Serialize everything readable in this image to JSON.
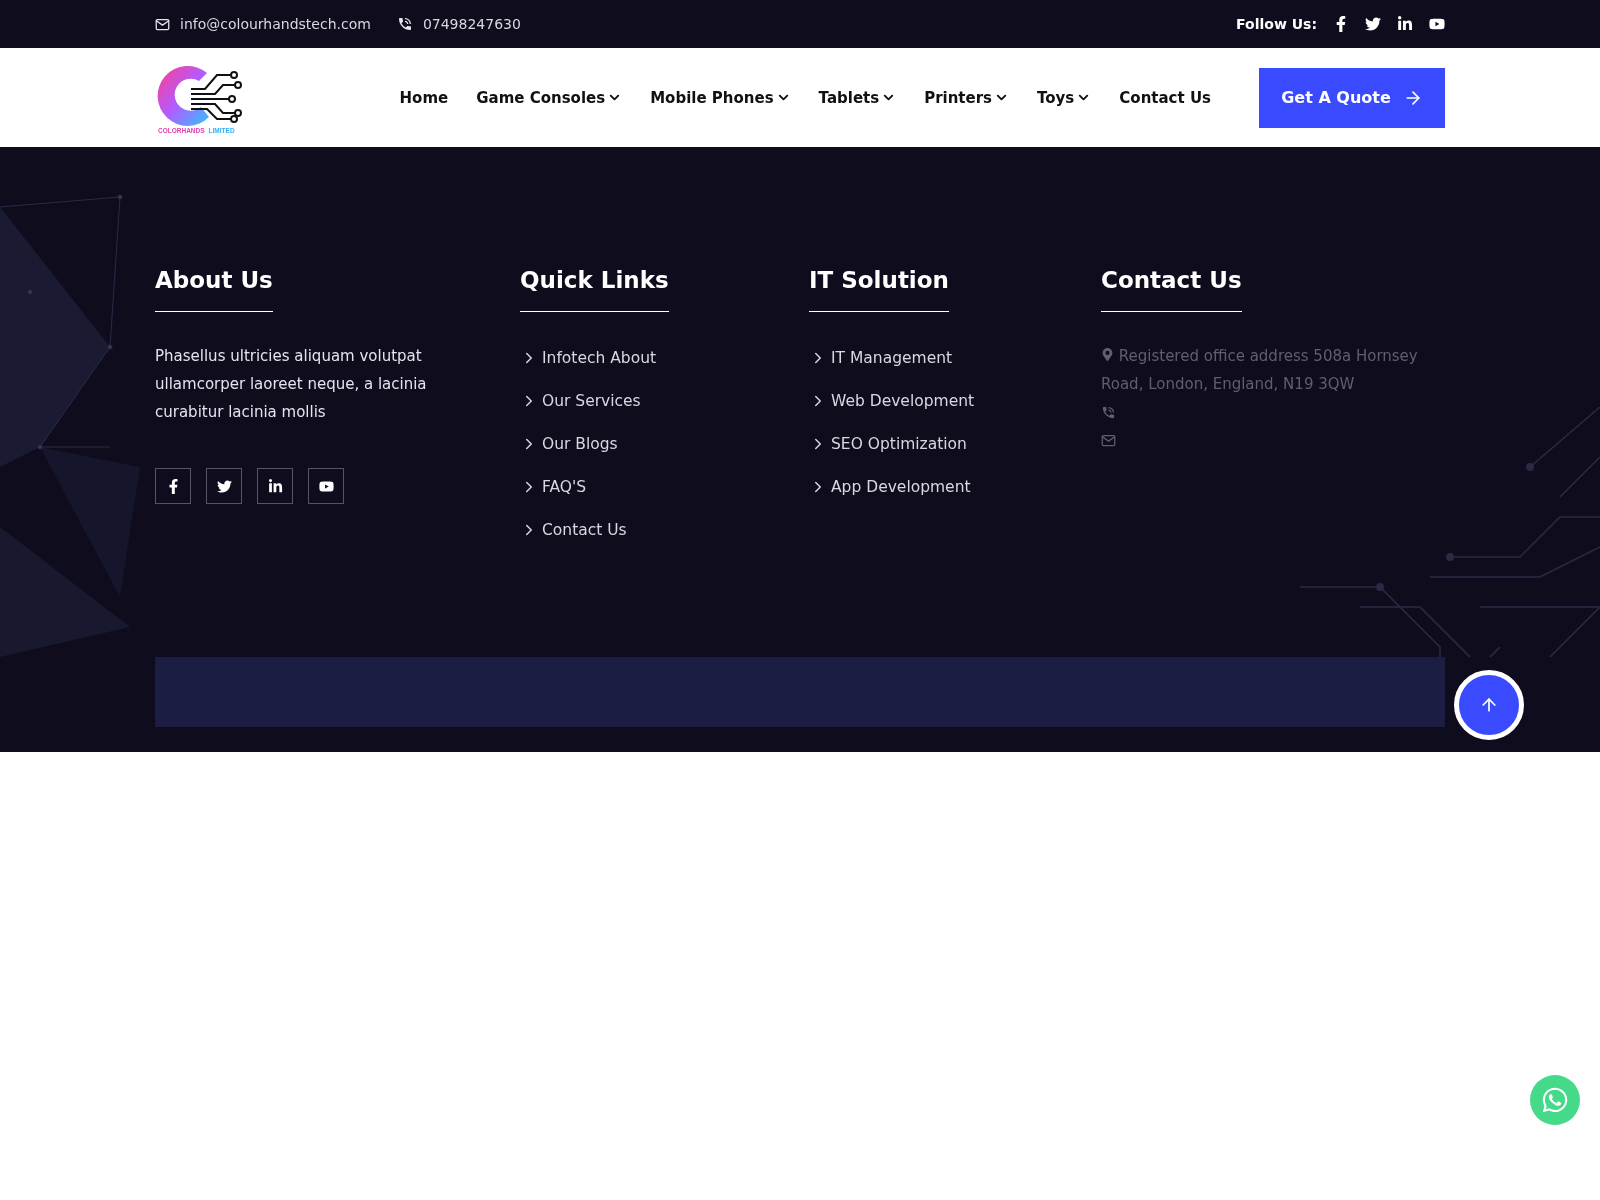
{
  "top_bar": {
    "email": "info@colourhandstech.com",
    "phone": "07498247630",
    "follow_label": "Follow Us:"
  },
  "logo": {
    "word_1": "COLORHANDS",
    "word_2": "LIMITED"
  },
  "nav": [
    {
      "label": "Home",
      "has_menu": false
    },
    {
      "label": "Game Consoles",
      "has_menu": true
    },
    {
      "label": "Mobile Phones",
      "has_menu": true
    },
    {
      "label": "Tablets",
      "has_menu": true
    },
    {
      "label": "Printers",
      "has_menu": true
    },
    {
      "label": "Toys",
      "has_menu": true
    },
    {
      "label": "Contact Us",
      "has_menu": false
    }
  ],
  "quote_button": "Get A Quote",
  "footer": {
    "about": {
      "title": "About Us",
      "text": "Phasellus ultricies aliquam volutpat ullamcorper laoreet neque, a lacinia curabitur lacinia mollis"
    },
    "quick_links": {
      "title": "Quick Links",
      "items": [
        "Infotech About",
        "Our Services",
        "Our Blogs",
        "FAQ'S",
        "Contact Us"
      ]
    },
    "it_solution": {
      "title": "IT Solution",
      "items": [
        "IT Management",
        "Web Development",
        "SEO Optimization",
        "App Development"
      ]
    },
    "contact": {
      "title": "Contact Us",
      "address": "Registered office address 508a Hornsey Road, London, England, N19 3QW"
    }
  }
}
